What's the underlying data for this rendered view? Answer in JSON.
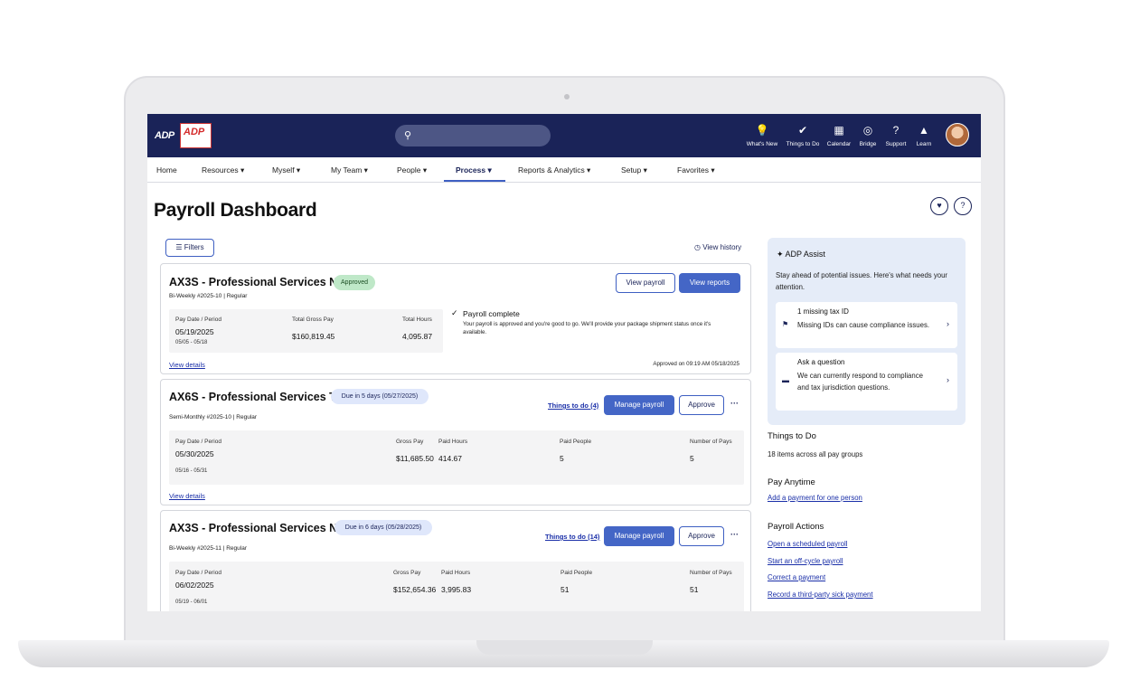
{
  "topbar": {
    "logo": "ADP",
    "client_logo": "ADP",
    "search_icon": "search-icon",
    "items": [
      {
        "label": "What's New",
        "icon": "lightbulb-icon",
        "glyph": "💡"
      },
      {
        "label": "Things to Do",
        "icon": "check-badge-icon",
        "glyph": "✔"
      },
      {
        "label": "Calendar",
        "icon": "calendar-icon",
        "glyph": "▦"
      },
      {
        "label": "Bridge",
        "icon": "bridge-icon",
        "glyph": "◎"
      },
      {
        "label": "Support",
        "icon": "help-icon",
        "glyph": "?"
      },
      {
        "label": "Learn",
        "icon": "graduation-cap-icon",
        "glyph": "▲"
      }
    ]
  },
  "nav": {
    "items": [
      {
        "label": "Home"
      },
      {
        "label": "Resources ▾"
      },
      {
        "label": "Myself ▾"
      },
      {
        "label": "My Team ▾"
      },
      {
        "label": "People ▾"
      },
      {
        "label": "Process ▾"
      },
      {
        "label": "Reports & Analytics ▾"
      },
      {
        "label": "Setup ▾"
      },
      {
        "label": "Favorites ▾"
      }
    ],
    "active": "Process"
  },
  "page": {
    "title": "Payroll Dashboard",
    "favorite_icon": "♥",
    "help_icon": "?",
    "filters_label": "☰ Filters",
    "view_history_label": "◷ View history"
  },
  "cards": [
    {
      "title": "AX3S - Professional Services N...",
      "status": "Approved",
      "subline": "Bi-Weekly #2025-10 | Regular",
      "buttons": [
        "View payroll",
        "View reports"
      ],
      "pay_date_label": "Pay Date / Period",
      "pay_date": "05/19/2025",
      "period": "05/05 - 05/18",
      "gross_label": "Total Gross Pay",
      "gross": "$160,819.45",
      "hours_label": "Total Hours",
      "hours": "4,095.87",
      "complete_title": "Payroll complete",
      "complete_text": "Your payroll is approved and you're good to go. We'll provide your package shipment status once it's available.",
      "view_details": "View details",
      "approved_on": "Approved on 09:19 AM 05/18/2025"
    },
    {
      "title": "AX6S - Professional Services T...",
      "status": "Due in 5 days (05/27/2025)",
      "subline": "Semi-Monthly #2025-10 | Regular",
      "things_to_do": "Things to do (4)",
      "buttons": [
        "Manage payroll",
        "Approve"
      ],
      "more": "···",
      "pay_date_label": "Pay Date / Period",
      "pay_date": "05/30/2025",
      "period": "05/16 - 05/31",
      "gross_label": "Gross Pay",
      "gross": "$11,685.50",
      "hours_label": "Paid Hours",
      "hours": "414.67",
      "people_label": "Paid People",
      "people": "5",
      "pays_label": "Number of Pays",
      "pays": "5",
      "view_details": "View details"
    },
    {
      "title": "AX3S - Professional Services N...",
      "status": "Due in 6 days (05/28/2025)",
      "subline": "Bi-Weekly #2025-11 | Regular",
      "things_to_do": "Things to do (14)",
      "buttons": [
        "Manage payroll",
        "Approve"
      ],
      "more": "···",
      "pay_date_label": "Pay Date / Period",
      "pay_date": "06/02/2025",
      "period": "05/19 - 06/01",
      "gross_label": "Gross Pay",
      "gross": "$152,654.36",
      "hours_label": "Paid Hours",
      "hours": "3,995.83",
      "people_label": "Paid People",
      "people": "51",
      "pays_label": "Number of Pays",
      "pays": "51"
    }
  ],
  "assist": {
    "title": "✦ ADP Assist",
    "description": "Stay ahead of potential issues. Here's what needs your attention.",
    "items": [
      {
        "title": "1 missing tax ID",
        "desc": "Missing IDs can cause compliance issues.",
        "icon": "flag-icon",
        "glyph": "⚑"
      },
      {
        "title": "Ask a question",
        "desc": "We can currently respond to compliance and tax jurisdiction questions.",
        "icon": "chat-icon",
        "glyph": "▬"
      }
    ],
    "chevron": "›"
  },
  "sidebar": {
    "things_to_do_title": "Things to Do",
    "things_to_do_text": "18 items across all pay groups",
    "pay_anytime_title": "Pay Anytime",
    "pay_anytime_link": "Add a payment for one person",
    "actions_title": "Payroll Actions",
    "actions": [
      "Open a scheduled payroll",
      "Start an off-cycle payroll",
      "Correct a payment",
      "Record a third-party sick payment"
    ]
  },
  "colors": {
    "topbar": "#1a2358",
    "accent": "#4466c6",
    "link": "#1a2fa8",
    "approved": "#bfe8c8"
  }
}
